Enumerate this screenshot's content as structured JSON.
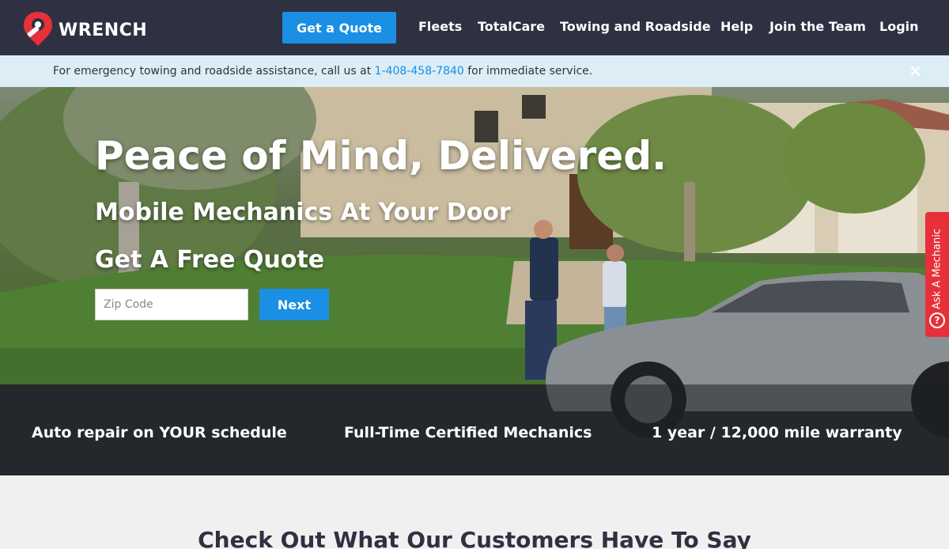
{
  "brand": {
    "name": "WRENCH",
    "accent": "#e8303a"
  },
  "nav": {
    "cta": "Get a Quote",
    "links": [
      "Fleets",
      "TotalCare",
      "Towing and Roadside",
      "Help",
      "Join the Team",
      "Login"
    ]
  },
  "alert": {
    "text_before": "For emergency towing and roadside assistance, call us at ",
    "phone": "1-408-458-7840",
    "text_after": " for immediate service.",
    "close_icon": "×"
  },
  "hero": {
    "title": "Peace of Mind, Delivered.",
    "subtitle": "Mobile Mechanics At Your Door",
    "quote_heading": "Get A Free Quote",
    "zip_placeholder": "Zip Code",
    "next_label": "Next"
  },
  "features": [
    "Auto repair on YOUR schedule",
    "Full-Time Certified Mechanics",
    "1 year / 12,000 mile warranty"
  ],
  "side_tab": {
    "label": "Ask A Mechanic",
    "icon": "?"
  },
  "testimonials": {
    "heading": "Check Out What Our Customers Have To Say"
  },
  "colors": {
    "nav_bg": "#2f3142",
    "primary_button": "#1a8fe3",
    "alert_bg": "#dcedf5",
    "ask_tab": "#e8303a"
  }
}
